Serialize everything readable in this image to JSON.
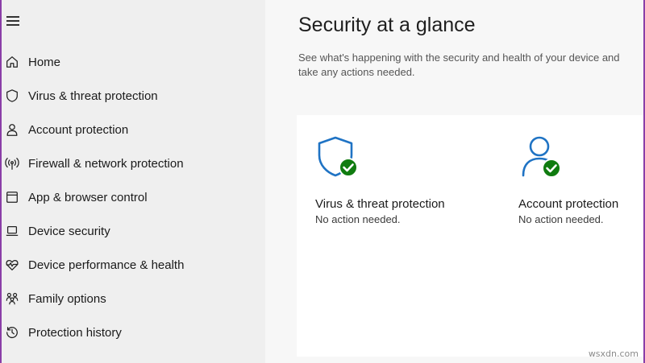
{
  "sidebar": {
    "items": [
      {
        "label": "Home",
        "icon": "home-icon"
      },
      {
        "label": "Virus & threat protection",
        "icon": "shield-icon"
      },
      {
        "label": "Account protection",
        "icon": "person-icon"
      },
      {
        "label": "Firewall & network protection",
        "icon": "antenna-icon"
      },
      {
        "label": "App & browser control",
        "icon": "app-window-icon"
      },
      {
        "label": "Device security",
        "icon": "laptop-icon"
      },
      {
        "label": "Device performance & health",
        "icon": "heart-pulse-icon"
      },
      {
        "label": "Family options",
        "icon": "family-icon"
      },
      {
        "label": "Protection history",
        "icon": "history-icon"
      }
    ]
  },
  "main": {
    "title": "Security at a glance",
    "subtitle": "See what's happening with the security and health of your device and take any actions needed.",
    "cards": [
      {
        "title": "Virus & threat protection",
        "status": "No action needed.",
        "icon": "shield-check-icon"
      },
      {
        "title": "Account protection",
        "status": "No action needed.",
        "icon": "person-check-icon"
      }
    ]
  },
  "watermark": "wsxdn.com",
  "colors": {
    "accent_blue": "#1f73c4",
    "check_green": "#107c10",
    "sidebar_bg": "#efefef",
    "frame": "#8a3ea8"
  }
}
